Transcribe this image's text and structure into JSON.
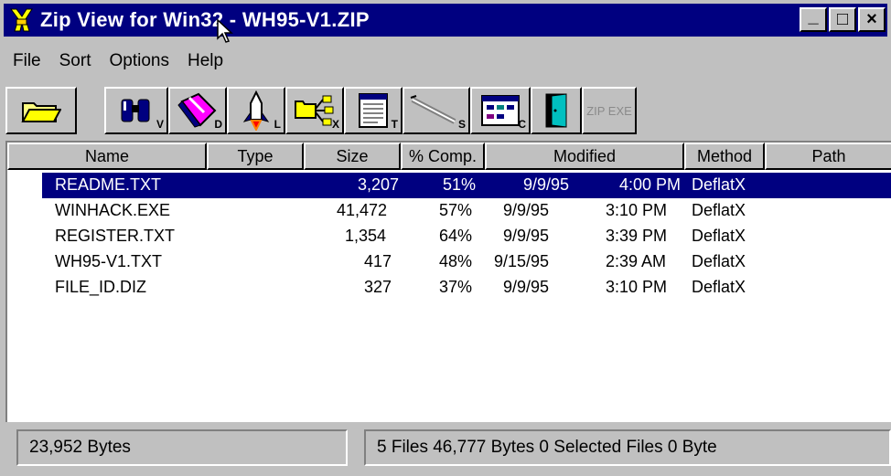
{
  "window": {
    "title": "Zip View for Win32 - WH95-V1.ZIP"
  },
  "title_buttons": {
    "minimize": "_",
    "maximize": "□",
    "close": "×"
  },
  "menu": [
    {
      "label": "File"
    },
    {
      "label": "Sort"
    },
    {
      "label": "Options"
    },
    {
      "label": "Help"
    }
  ],
  "toolbar": [
    {
      "name": "open",
      "sub": ""
    },
    {
      "name": "view",
      "sub": "V"
    },
    {
      "name": "delete",
      "sub": "D"
    },
    {
      "name": "launch",
      "sub": "L"
    },
    {
      "name": "extract",
      "sub": "X"
    },
    {
      "name": "text",
      "sub": "T"
    },
    {
      "name": "settings",
      "sub": "S"
    },
    {
      "name": "checkout",
      "sub": "C"
    },
    {
      "name": "exit",
      "sub": ""
    },
    {
      "name": "zip-exe",
      "label": "ZIP EXE",
      "disabled": true
    }
  ],
  "columns": [
    "Name",
    "Type",
    "Size",
    "% Comp.",
    "Modified",
    "Method",
    "Path"
  ],
  "rows": [
    {
      "name": "README.TXT",
      "type": "",
      "size": "3,207",
      "comp": "51%",
      "date": "9/9/95",
      "time": "4:00 PM",
      "method": "DeflatX",
      "path": "",
      "selected": true
    },
    {
      "name": "WINHACK.EXE",
      "type": "",
      "size": "41,472",
      "comp": "57%",
      "date": "9/9/95",
      "time": "3:10 PM",
      "method": "DeflatX",
      "path": ""
    },
    {
      "name": "REGISTER.TXT",
      "type": "",
      "size": "1,354",
      "comp": "64%",
      "date": "9/9/95",
      "time": "3:39 PM",
      "method": "DeflatX",
      "path": ""
    },
    {
      "name": "WH95-V1.TXT",
      "type": "",
      "size": "417",
      "comp": "48%",
      "date": "9/15/95",
      "time": "2:39 AM",
      "method": "DeflatX",
      "path": ""
    },
    {
      "name": "FILE_ID.DIZ",
      "type": "",
      "size": "327",
      "comp": "37%",
      "date": "9/9/95",
      "time": "3:10 PM",
      "method": "DeflatX",
      "path": ""
    }
  ],
  "status": {
    "left": "23,952 Bytes",
    "right": "5 Files  46,777 Bytes   0 Selected Files      0 Byte"
  },
  "colors": {
    "titlebar": "#000080",
    "selection": "#000080",
    "face": "#c0c0c0"
  }
}
